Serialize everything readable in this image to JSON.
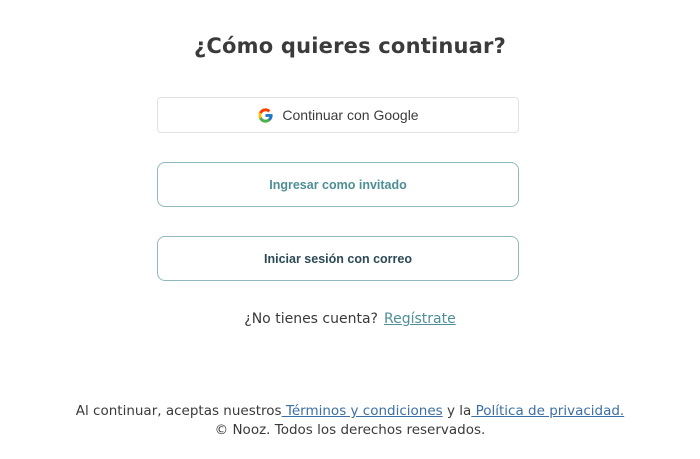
{
  "heading": "¿Cómo quieres continuar?",
  "buttons": {
    "google_label": "Continuar con Google",
    "guest_label": "Ingresar como invitado",
    "email_label": "Iniciar sesión con correo"
  },
  "signup": {
    "prompt": "¿No tienes cuenta?",
    "link_label": "Regístrate"
  },
  "footer": {
    "prefix": "Al continuar, aceptas nuestros",
    "terms_link": " Términos y condiciones",
    "middle": " y la",
    "privacy_link": " Política de privacidad.",
    "copyright": "© Nooz. Todos los derechos reservados."
  },
  "colors": {
    "accent_teal": "#4e8f96",
    "dark_teal": "#2c4a55",
    "outline": "#8fb9bd",
    "footer_link": "#3c6fa5"
  },
  "icons": {
    "google": "google-g-icon"
  }
}
